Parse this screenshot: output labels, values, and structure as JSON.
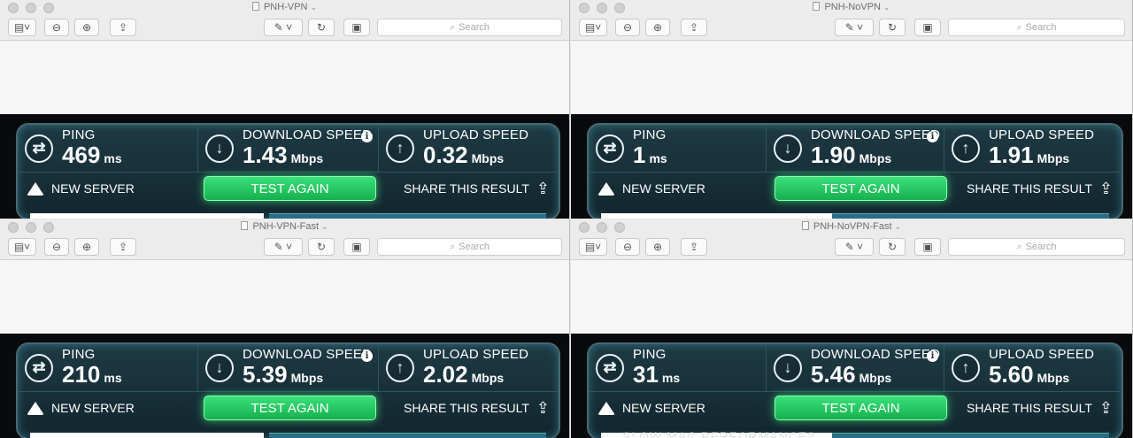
{
  "search_placeholder": "Search",
  "windows": [
    {
      "title": "PNH-VPN",
      "ping": {
        "label": "PING",
        "value": "469",
        "unit": "ms"
      },
      "download": {
        "label": "DOWNLOAD SPEED",
        "value": "1.43",
        "unit": "Mbps"
      },
      "upload": {
        "label": "UPLOAD SPEED",
        "value": "0.32",
        "unit": "Mbps"
      },
      "new_server": "NEW SERVER",
      "test_again": "TEST AGAIN",
      "share": "SHARE THIS RESULT",
      "footer_text": ""
    },
    {
      "title": "PNH-NoVPN",
      "ping": {
        "label": "PING",
        "value": "1",
        "unit": "ms"
      },
      "download": {
        "label": "DOWNLOAD SPEED",
        "value": "1.90",
        "unit": "Mbps"
      },
      "upload": {
        "label": "UPLOAD SPEED",
        "value": "1.91",
        "unit": "Mbps"
      },
      "new_server": "NEW SERVER",
      "test_again": "TEST AGAIN",
      "share": "SHARE THIS RESULT",
      "footer_text": ""
    },
    {
      "title": "PNH-VPN-Fast",
      "ping": {
        "label": "PING",
        "value": "210",
        "unit": "ms"
      },
      "download": {
        "label": "DOWNLOAD SPEED",
        "value": "5.39",
        "unit": "Mbps"
      },
      "upload": {
        "label": "UPLOAD SPEED",
        "value": "2.02",
        "unit": "Mbps"
      },
      "new_server": "NEW SERVER",
      "test_again": "TEST AGAIN",
      "share": "SHARE THIS RESULT",
      "footer_text": ""
    },
    {
      "title": "PNH-NoVPN-Fast",
      "ping": {
        "label": "PING",
        "value": "31",
        "unit": "ms"
      },
      "download": {
        "label": "DOWNLOAD SPEED",
        "value": "5.46",
        "unit": "Mbps"
      },
      "upload": {
        "label": "UPLOAD SPEED",
        "value": "5.60",
        "unit": "Mbps"
      },
      "new_server": "NEW SERVER",
      "test_again": "TEST AGAIN",
      "share": "SHARE THIS RESULT",
      "footer_text": "SLOW MAC PERFORMANCE?"
    }
  ],
  "colors": {
    "accent_green": "#22c45d",
    "panel": "#1b333c",
    "dark_bg": "#090a0d"
  }
}
